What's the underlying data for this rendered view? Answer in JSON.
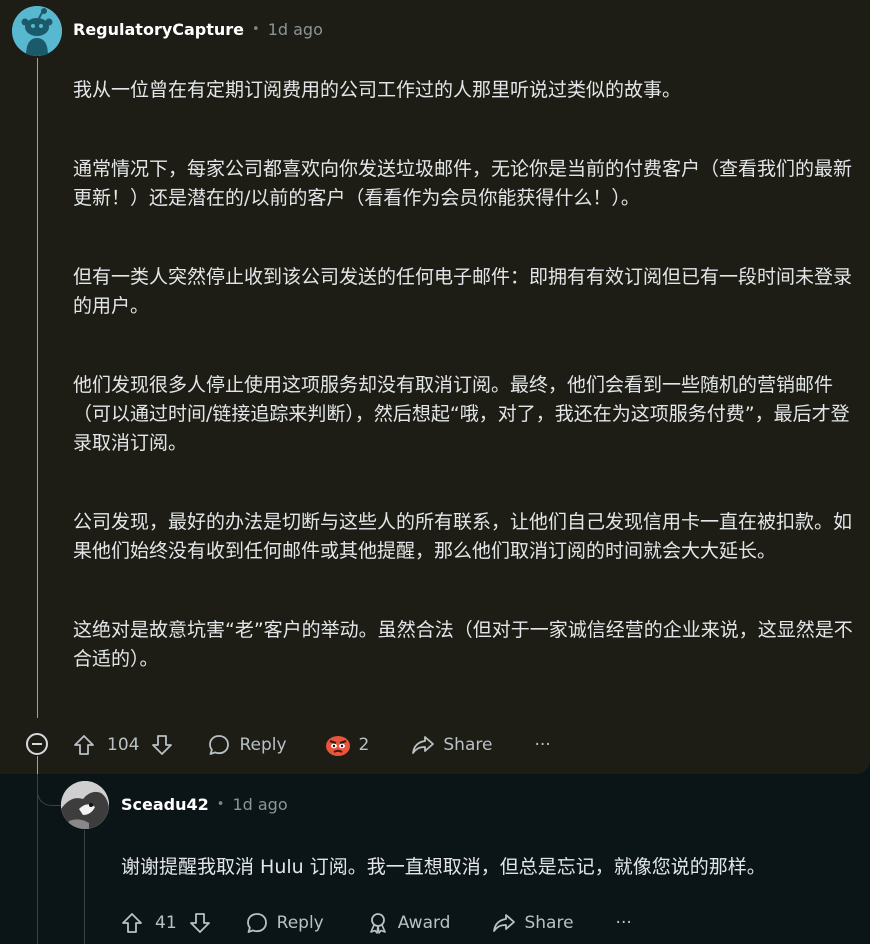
{
  "comment1": {
    "username": "RegulatoryCapture",
    "separator": "•",
    "time": "1d ago",
    "paragraphs": [
      "我从一位曾在有定期订阅费用的公司工作过的人那里听说过类似的故事。",
      "通常情况下，每家公司都喜欢向你发送垃圾邮件，无论你是当前的付费客户（查看我们的最新更新！）还是潜在的/以前的客户（看看作为会员你能获得什么！）。",
      "但有一类人突然停止收到该公司发送的任何电子邮件：即拥有有效订阅但已有一段时间未登录的用户。",
      "他们发现很多人停止使用这项服务却没有取消订阅。最终，他们会看到一些随机的营销邮件（可以通过时间/链接追踪来判断），然后想起“哦，对了，我还在为这项服务付费”，最后才登录取消订阅。",
      "公司发现，最好的办法是切断与这些人的所有联系，让他们自己发现信用卡一直在被扣款。如果他们始终没有收到任何邮件或其他提醒，那么他们取消订阅的时间就会大大延长。",
      "这绝对是故意坑害“老”客户的举动。虽然合法（但对于一家诚信经营的企业来说，这显然是不合适的）。"
    ],
    "votes": "104",
    "reply_label": "Reply",
    "award_count": "2",
    "share_label": "Share",
    "more_label": "···"
  },
  "comment2": {
    "username": "Sceadu42",
    "separator": "•",
    "time": "1d ago",
    "text": "谢谢提醒我取消 Hulu 订阅。我一直想取消，但总是忘记，就像您说的那样。",
    "votes": "41",
    "reply_label": "Reply",
    "award_label": "Award",
    "share_label": "Share",
    "more_label": "···"
  },
  "colors": {
    "page_bg": "#0b1416",
    "highlight_bg": "#1d1d15",
    "thread_highlight": "#c9a33a",
    "avatar_bg": "#58b8cf"
  }
}
